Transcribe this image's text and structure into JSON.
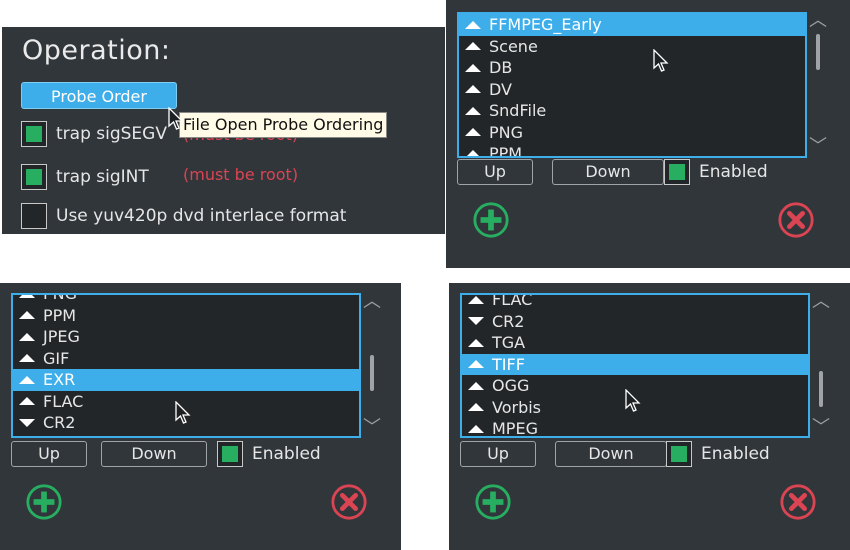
{
  "operation": {
    "title": "Operation:",
    "probe_order_label": "Probe Order",
    "tooltip": "File Open Probe Ordering",
    "trap_sigsegv": {
      "label": "trap sigSEGV",
      "checked": true,
      "note": "(must be root)"
    },
    "trap_sigint": {
      "label": "trap sigINT",
      "checked": true,
      "note": "(must be root)"
    },
    "yuv420p": {
      "label": "Use yuv420p dvd interlace format",
      "checked": false
    }
  },
  "colors": {
    "accent": "#3daee9",
    "panel_bg": "#31363b",
    "list_bg": "#232629",
    "check_green": "#27ae60",
    "warning_red": "#da4453",
    "add_green": "#27ae60",
    "remove_red": "#da4453"
  },
  "buttons": {
    "up": "Up",
    "down": "Down",
    "enabled": "Enabled"
  },
  "probe_lists": [
    {
      "items": [
        {
          "label": "FFMPEG_Early",
          "arrow": "up",
          "selected": true
        },
        {
          "label": "Scene",
          "arrow": "up",
          "selected": false
        },
        {
          "label": "DB",
          "arrow": "up",
          "selected": false
        },
        {
          "label": "DV",
          "arrow": "up",
          "selected": false
        },
        {
          "label": "SndFile",
          "arrow": "up",
          "selected": false
        },
        {
          "label": "PNG",
          "arrow": "up",
          "selected": false
        },
        {
          "label": "PPM",
          "arrow": "up",
          "selected": false
        }
      ],
      "enabled": true
    },
    {
      "items": [
        {
          "label": "PNG",
          "arrow": "up",
          "selected": false
        },
        {
          "label": "PPM",
          "arrow": "up",
          "selected": false
        },
        {
          "label": "JPEG",
          "arrow": "up",
          "selected": false
        },
        {
          "label": "GIF",
          "arrow": "up",
          "selected": false
        },
        {
          "label": "EXR",
          "arrow": "up",
          "selected": true
        },
        {
          "label": "FLAC",
          "arrow": "up",
          "selected": false
        },
        {
          "label": "CR2",
          "arrow": "down",
          "selected": false
        }
      ],
      "enabled": true
    },
    {
      "items": [
        {
          "label": "FLAC",
          "arrow": "up",
          "selected": false
        },
        {
          "label": "CR2",
          "arrow": "down",
          "selected": false
        },
        {
          "label": "TGA",
          "arrow": "up",
          "selected": false
        },
        {
          "label": "TIFF",
          "arrow": "up",
          "selected": true
        },
        {
          "label": "OGG",
          "arrow": "up",
          "selected": false
        },
        {
          "label": "Vorbis",
          "arrow": "up",
          "selected": false
        },
        {
          "label": "MPEG",
          "arrow": "up",
          "selected": false
        }
      ],
      "enabled": true
    }
  ],
  "icons": {
    "add": "plus-circle-icon",
    "remove": "x-circle-icon",
    "cursor": "mouse-pointer-icon",
    "scroll_up": "chevron-up-icon",
    "scroll_down": "chevron-down-icon"
  }
}
